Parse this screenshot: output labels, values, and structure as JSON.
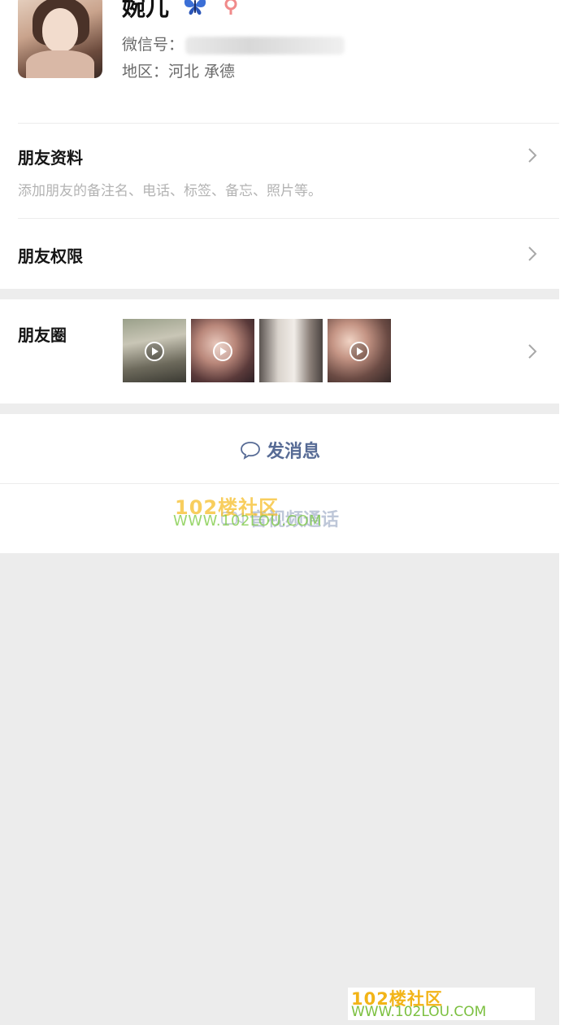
{
  "profile": {
    "nickname": "婉儿",
    "wechat_id_label": "微信号：",
    "region": "地区：河北 承德",
    "icons": {
      "badge": "butterfly-icon",
      "gender": "female-icon"
    },
    "gender_color": "#f08a8a",
    "badge_color": "#3b6fd6"
  },
  "rows": {
    "friend_info": {
      "title": "朋友资料",
      "subtitle": "添加朋友的备注名、电话、标签、备忘、照片等。"
    },
    "friend_permissions": {
      "title": "朋友权限"
    },
    "moments": {
      "title": "朋友圈",
      "thumbnail_count": 4
    }
  },
  "actions": {
    "send_message": "发消息",
    "video_call": "音视频通话"
  },
  "watermarks": {
    "middle": {
      "line1": "102楼社区",
      "line2": "WWW.102LOU.COM"
    },
    "bottom": {
      "line1": "102楼社区",
      "line2": "WWW.102LOU.COM"
    }
  },
  "colors": {
    "link": "#576b95",
    "background_gray": "#ededed",
    "divider": "#ececec"
  }
}
